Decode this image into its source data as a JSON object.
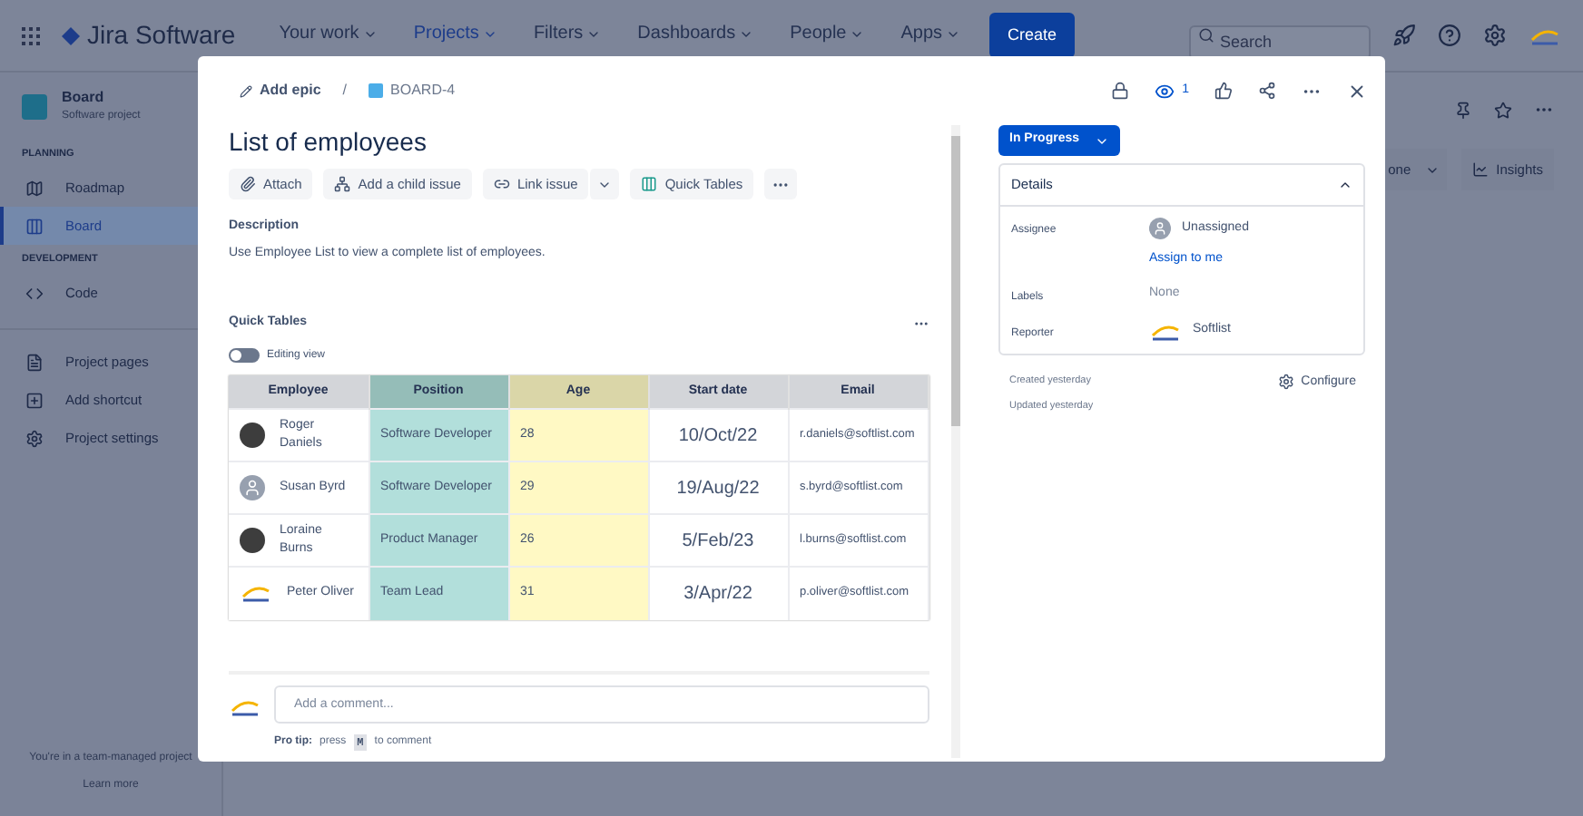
{
  "topbar": {
    "app_name": "Jira Software",
    "nav": [
      {
        "label": "Your work",
        "selected": false
      },
      {
        "label": "Projects",
        "selected": true
      },
      {
        "label": "Filters",
        "selected": false
      },
      {
        "label": "Dashboards",
        "selected": false
      },
      {
        "label": "People",
        "selected": false
      },
      {
        "label": "Apps",
        "selected": false
      }
    ],
    "create": "Create",
    "search": {
      "placeholder": "Search"
    }
  },
  "sidebar": {
    "project": {
      "name": "Board",
      "type": "Software project"
    },
    "sections": [
      {
        "heading": "PLANNING",
        "items": [
          {
            "label": "Roadmap",
            "selected": false
          },
          {
            "label": "Board",
            "selected": true
          }
        ]
      },
      {
        "heading": "DEVELOPMENT",
        "items": [
          {
            "label": "Code",
            "selected": false
          }
        ]
      },
      {
        "items": [
          {
            "label": "Project pages",
            "selected": false
          },
          {
            "label": "Add shortcut",
            "selected": false
          },
          {
            "label": "Project settings",
            "selected": false
          }
        ]
      }
    ],
    "footer": {
      "text": "You're in a team-managed project",
      "link": "Learn more"
    }
  },
  "background": {
    "group_by": "one",
    "insights": "Insights"
  },
  "issue": {
    "add_epic": "Add epic",
    "separator": "/",
    "key": "BOARD-4",
    "watchers": "1",
    "title": "List of employees",
    "toolbar": [
      {
        "label": "Attach"
      },
      {
        "label": "Add a child issue"
      },
      {
        "label": "Link issue"
      },
      {
        "label": "Quick Tables"
      }
    ],
    "description": {
      "heading": "Description",
      "text": "Use Employee List to view a complete list of employees."
    },
    "quick_tables": {
      "heading": "Quick Tables",
      "toggle": {
        "label": "Editing view",
        "on": false
      },
      "columns": [
        {
          "label": "Employee",
          "color": "#d3d5d9"
        },
        {
          "label": "Position",
          "color": "#95bdb8"
        },
        {
          "label": "Age",
          "color": "#dad6a8"
        },
        {
          "label": "Start date",
          "color": "#d3d5d9"
        },
        {
          "label": "Email",
          "color": "#d3d5d9"
        }
      ],
      "rows": [
        {
          "kind": "photo",
          "name": "Roger Daniels",
          "position": "Software Developer",
          "age": "28",
          "start": "10/Oct/22",
          "email": "r.daniels@softlist.com"
        },
        {
          "kind": "person",
          "name": "Susan Byrd",
          "position": "Software Developer",
          "age": "29",
          "start": "19/Aug/22",
          "email": "s.byrd@softlist.com"
        },
        {
          "kind": "photo",
          "name": "Loraine Burns",
          "position": "Product Manager",
          "age": "26",
          "start": "5/Feb/23",
          "email": "l.burns@softlist.com"
        },
        {
          "kind": "logo",
          "name": "Peter Oliver",
          "position": "Team Lead",
          "age": "31",
          "start": "3/Apr/22",
          "email": "p.oliver@softlist.com"
        }
      ]
    },
    "comment": {
      "placeholder": "Add a comment...",
      "tip_label": "Pro tip:",
      "tip_before": "press",
      "tip_key": "M",
      "tip_after": "to comment"
    },
    "status": "In Progress",
    "details": {
      "heading": "Details",
      "expanded": true,
      "fields": [
        {
          "label": "Assignee",
          "kind": "assignee",
          "value": "Unassigned",
          "action": "Assign to me"
        },
        {
          "label": "Labels",
          "kind": "empty",
          "value": "None"
        },
        {
          "label": "Reporter",
          "kind": "reporter",
          "value": "Softlist"
        }
      ]
    },
    "created": "Created yesterday",
    "updated": "Updated yesterday",
    "configure": "Configure"
  }
}
